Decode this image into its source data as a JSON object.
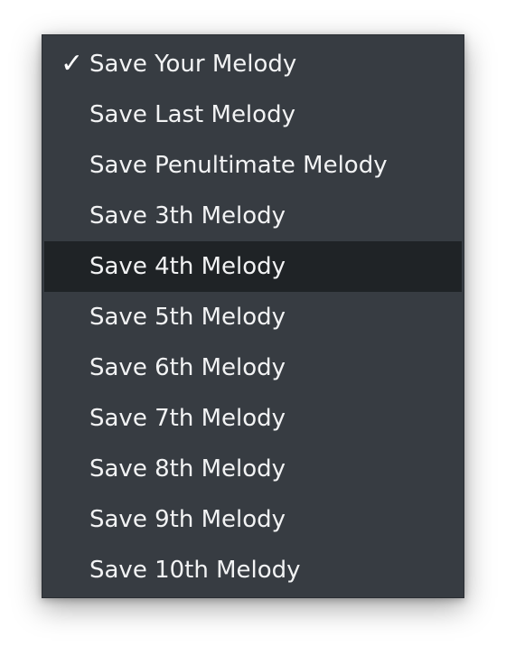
{
  "menu": {
    "items": [
      {
        "label": "Save Your Melody",
        "checked": true
      },
      {
        "label": "Save Last Melody",
        "checked": false
      },
      {
        "label": "Save Penultimate Melody",
        "checked": false
      },
      {
        "label": "Save 3th Melody",
        "checked": false
      },
      {
        "label": "Save 4th Melody",
        "checked": false,
        "highlighted": true
      },
      {
        "label": "Save 5th Melody",
        "checked": false
      },
      {
        "label": "Save 6th Melody",
        "checked": false
      },
      {
        "label": "Save 7th Melody",
        "checked": false
      },
      {
        "label": "Save 8th Melody",
        "checked": false
      },
      {
        "label": "Save 9th Melody",
        "checked": false
      },
      {
        "label": "Save 10th Melody",
        "checked": false
      }
    ],
    "check_glyph": "✓",
    "colors": {
      "background": "#373c42",
      "highlight": "#1f2326",
      "text": "#f2f3f4"
    }
  }
}
